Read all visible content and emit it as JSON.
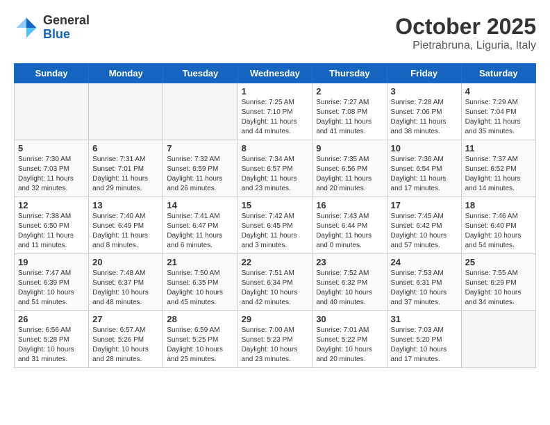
{
  "header": {
    "logo_general": "General",
    "logo_blue": "Blue",
    "month_title": "October 2025",
    "subtitle": "Pietrabruna, Liguria, Italy"
  },
  "weekdays": [
    "Sunday",
    "Monday",
    "Tuesday",
    "Wednesday",
    "Thursday",
    "Friday",
    "Saturday"
  ],
  "weeks": [
    [
      {
        "day": "",
        "info": ""
      },
      {
        "day": "",
        "info": ""
      },
      {
        "day": "",
        "info": ""
      },
      {
        "day": "1",
        "info": "Sunrise: 7:25 AM\nSunset: 7:10 PM\nDaylight: 11 hours and 44 minutes."
      },
      {
        "day": "2",
        "info": "Sunrise: 7:27 AM\nSunset: 7:08 PM\nDaylight: 11 hours and 41 minutes."
      },
      {
        "day": "3",
        "info": "Sunrise: 7:28 AM\nSunset: 7:06 PM\nDaylight: 11 hours and 38 minutes."
      },
      {
        "day": "4",
        "info": "Sunrise: 7:29 AM\nSunset: 7:04 PM\nDaylight: 11 hours and 35 minutes."
      }
    ],
    [
      {
        "day": "5",
        "info": "Sunrise: 7:30 AM\nSunset: 7:03 PM\nDaylight: 11 hours and 32 minutes."
      },
      {
        "day": "6",
        "info": "Sunrise: 7:31 AM\nSunset: 7:01 PM\nDaylight: 11 hours and 29 minutes."
      },
      {
        "day": "7",
        "info": "Sunrise: 7:32 AM\nSunset: 6:59 PM\nDaylight: 11 hours and 26 minutes."
      },
      {
        "day": "8",
        "info": "Sunrise: 7:34 AM\nSunset: 6:57 PM\nDaylight: 11 hours and 23 minutes."
      },
      {
        "day": "9",
        "info": "Sunrise: 7:35 AM\nSunset: 6:56 PM\nDaylight: 11 hours and 20 minutes."
      },
      {
        "day": "10",
        "info": "Sunrise: 7:36 AM\nSunset: 6:54 PM\nDaylight: 11 hours and 17 minutes."
      },
      {
        "day": "11",
        "info": "Sunrise: 7:37 AM\nSunset: 6:52 PM\nDaylight: 11 hours and 14 minutes."
      }
    ],
    [
      {
        "day": "12",
        "info": "Sunrise: 7:38 AM\nSunset: 6:50 PM\nDaylight: 11 hours and 11 minutes."
      },
      {
        "day": "13",
        "info": "Sunrise: 7:40 AM\nSunset: 6:49 PM\nDaylight: 11 hours and 8 minutes."
      },
      {
        "day": "14",
        "info": "Sunrise: 7:41 AM\nSunset: 6:47 PM\nDaylight: 11 hours and 6 minutes."
      },
      {
        "day": "15",
        "info": "Sunrise: 7:42 AM\nSunset: 6:45 PM\nDaylight: 11 hours and 3 minutes."
      },
      {
        "day": "16",
        "info": "Sunrise: 7:43 AM\nSunset: 6:44 PM\nDaylight: 11 hours and 0 minutes."
      },
      {
        "day": "17",
        "info": "Sunrise: 7:45 AM\nSunset: 6:42 PM\nDaylight: 10 hours and 57 minutes."
      },
      {
        "day": "18",
        "info": "Sunrise: 7:46 AM\nSunset: 6:40 PM\nDaylight: 10 hours and 54 minutes."
      }
    ],
    [
      {
        "day": "19",
        "info": "Sunrise: 7:47 AM\nSunset: 6:39 PM\nDaylight: 10 hours and 51 minutes."
      },
      {
        "day": "20",
        "info": "Sunrise: 7:48 AM\nSunset: 6:37 PM\nDaylight: 10 hours and 48 minutes."
      },
      {
        "day": "21",
        "info": "Sunrise: 7:50 AM\nSunset: 6:35 PM\nDaylight: 10 hours and 45 minutes."
      },
      {
        "day": "22",
        "info": "Sunrise: 7:51 AM\nSunset: 6:34 PM\nDaylight: 10 hours and 42 minutes."
      },
      {
        "day": "23",
        "info": "Sunrise: 7:52 AM\nSunset: 6:32 PM\nDaylight: 10 hours and 40 minutes."
      },
      {
        "day": "24",
        "info": "Sunrise: 7:53 AM\nSunset: 6:31 PM\nDaylight: 10 hours and 37 minutes."
      },
      {
        "day": "25",
        "info": "Sunrise: 7:55 AM\nSunset: 6:29 PM\nDaylight: 10 hours and 34 minutes."
      }
    ],
    [
      {
        "day": "26",
        "info": "Sunrise: 6:56 AM\nSunset: 5:28 PM\nDaylight: 10 hours and 31 minutes."
      },
      {
        "day": "27",
        "info": "Sunrise: 6:57 AM\nSunset: 5:26 PM\nDaylight: 10 hours and 28 minutes."
      },
      {
        "day": "28",
        "info": "Sunrise: 6:59 AM\nSunset: 5:25 PM\nDaylight: 10 hours and 25 minutes."
      },
      {
        "day": "29",
        "info": "Sunrise: 7:00 AM\nSunset: 5:23 PM\nDaylight: 10 hours and 23 minutes."
      },
      {
        "day": "30",
        "info": "Sunrise: 7:01 AM\nSunset: 5:22 PM\nDaylight: 10 hours and 20 minutes."
      },
      {
        "day": "31",
        "info": "Sunrise: 7:03 AM\nSunset: 5:20 PM\nDaylight: 10 hours and 17 minutes."
      },
      {
        "day": "",
        "info": ""
      }
    ]
  ]
}
